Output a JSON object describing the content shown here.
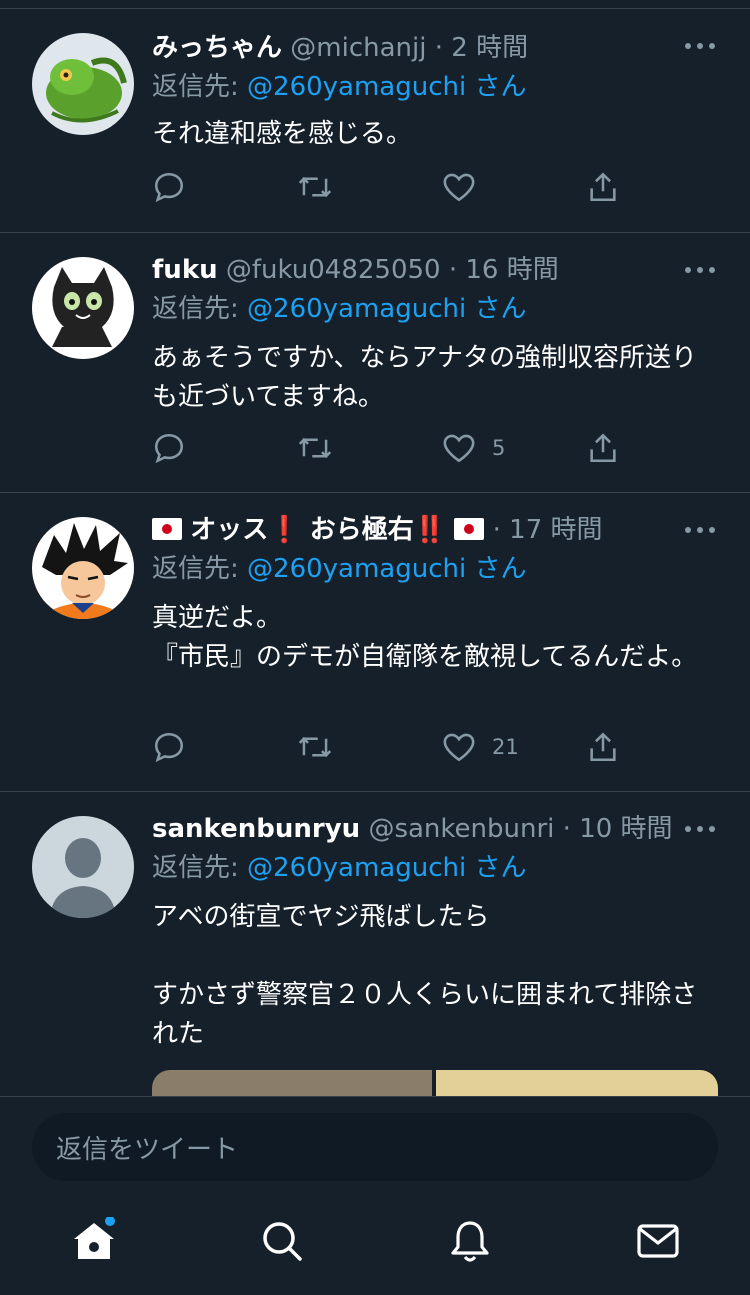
{
  "tweets": [
    {
      "name": "みっちゃん",
      "handle": "@michanjj",
      "dot": "·",
      "time": "2 時間",
      "reply_label": "返信先: ",
      "reply_mention": "@260yamaguchi",
      "reply_suffix": " さん",
      "text": "それ違和感を感じる。",
      "likes": ""
    },
    {
      "name": "fuku",
      "handle": "@fuku04825050",
      "dot": "·",
      "time": "16 時間",
      "reply_label": "返信先: ",
      "reply_mention": "@260yamaguchi",
      "reply_suffix": " さん",
      "text": "あぁそうですか、ならアナタの強制収容所送りも近づいてますね。",
      "likes": "5"
    },
    {
      "name_parts": [
        "オッス",
        "❗",
        " おら極右",
        "‼️"
      ],
      "handle": "",
      "dot": "·",
      "time": "17 時間",
      "reply_label": "返信先: ",
      "reply_mention": "@260yamaguchi",
      "reply_suffix": " さん",
      "text": "真逆だよ。\n『市民』のデモが自衛隊を敵視してるんだよ。",
      "likes": "21"
    },
    {
      "name": "sankenbunryu",
      "handle": "@sankenbunri",
      "dot": "·",
      "time": "10 時間",
      "reply_label": "返信先: ",
      "reply_mention": "@260yamaguchi",
      "reply_suffix": " さん",
      "text": "アベの街宣でヤジ飛ばしたら\n\nすかさず警察官２０人くらいに囲まれて排除された",
      "likes": ""
    }
  ],
  "reply_box": {
    "placeholder": "返信をツイート"
  },
  "nav": [
    "home-icon",
    "search-icon",
    "notifications-icon",
    "messages-icon"
  ],
  "colors": {
    "background": "#15202b",
    "separator": "#38444d",
    "accent": "#1da1f2",
    "muted": "#8899a6",
    "notification_dot": "#1da1f2"
  }
}
